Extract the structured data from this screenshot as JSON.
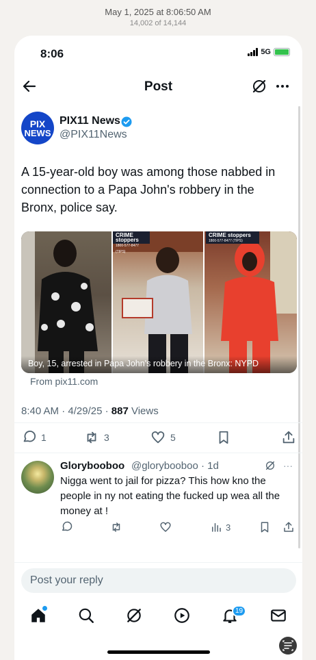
{
  "photos": {
    "date": "May 1, 2025 at 8:06:50 AM",
    "count": "14,002 of 14,144"
  },
  "status": {
    "time": "8:06",
    "network": "5G"
  },
  "nav": {
    "title": "Post"
  },
  "post": {
    "avatar_line1": "PIX",
    "avatar_line2": "NEWS",
    "author": "PIX11 News",
    "handle": "@PIX11News",
    "text": "A 15-year-old boy was among those nabbed in connection to a Papa John's robbery in the Bronx, police say.",
    "media": {
      "caption": "Boy, 15, arrested in Papa John's robbery in the Bronx: NYPD",
      "badge_title": "CRIME stoppers",
      "badge_number": "1800-577-8477 (TIPS)",
      "source": "From pix11.com"
    },
    "time": "8:40 AM",
    "date": "4/29/25",
    "views": "887",
    "views_label": "Views",
    "stats": {
      "replies": "1",
      "reposts": "3",
      "likes": "5"
    }
  },
  "reply": {
    "name": "Glorybooboo",
    "handle": "@glorybooboo · 1d",
    "more": "···",
    "text": "Nigga went to jail for pizza? This how kno the people in ny not eating the fucked up wea all the money at !",
    "views": "3"
  },
  "compose": {
    "placeholder": "Post your reply"
  },
  "tabs": {
    "notifications_count": "19"
  },
  "colors": {
    "accent": "#1d9bf0",
    "secondary_text": "#536471"
  }
}
